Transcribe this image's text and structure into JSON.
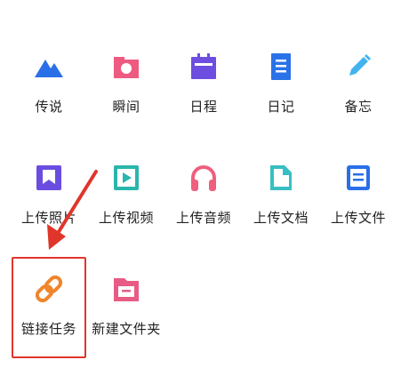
{
  "rows": [
    [
      {
        "id": "legend",
        "label": "传说",
        "icon": "mountain-icon",
        "color": "#2a6fe8"
      },
      {
        "id": "moment",
        "label": "瞬间",
        "icon": "camera-frame-icon",
        "color": "#ee5a80"
      },
      {
        "id": "schedule",
        "label": "日程",
        "icon": "calendar-icon",
        "color": "#6d4ee0"
      },
      {
        "id": "diary",
        "label": "日记",
        "icon": "notebook-icon",
        "color": "#2a72e8"
      },
      {
        "id": "memo",
        "label": "备忘",
        "icon": "pencil-icon",
        "color": "#43b3f0"
      }
    ],
    [
      {
        "id": "upload-photo",
        "label": "上传照片",
        "icon": "bookmark-frame-icon",
        "color": "#6a4de0"
      },
      {
        "id": "upload-video",
        "label": "上传视频",
        "icon": "play-icon",
        "color": "#2bb5ad"
      },
      {
        "id": "upload-audio",
        "label": "上传音频",
        "icon": "headphones-icon",
        "color": "#ef5f7e"
      },
      {
        "id": "upload-doc",
        "label": "上传文档",
        "icon": "document-icon",
        "color": "#38bfc2"
      },
      {
        "id": "upload-file",
        "label": "上传文件",
        "icon": "file-box-icon",
        "color": "#2a6fe8"
      }
    ],
    [
      {
        "id": "link-task",
        "label": "链接任务",
        "icon": "link-icon",
        "color": "#f0852b"
      },
      {
        "id": "new-folder",
        "label": "新建文件夹",
        "icon": "folder-icon",
        "color": "#e75b85"
      }
    ]
  ],
  "highlight_color": "#e0352b"
}
